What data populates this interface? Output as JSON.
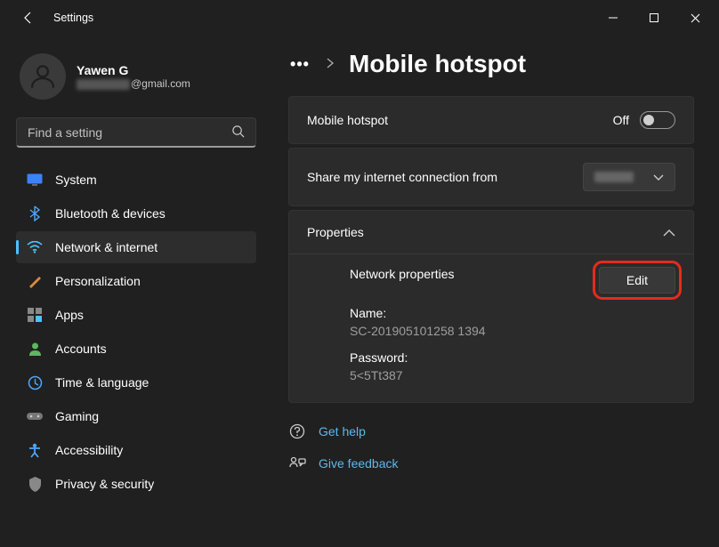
{
  "app": {
    "title": "Settings"
  },
  "profile": {
    "name": "Yawen G",
    "email_suffix": "@gmail.com"
  },
  "search": {
    "placeholder": "Find a setting"
  },
  "sidebar": {
    "items": [
      {
        "label": "System"
      },
      {
        "label": "Bluetooth & devices"
      },
      {
        "label": "Network & internet"
      },
      {
        "label": "Personalization"
      },
      {
        "label": "Apps"
      },
      {
        "label": "Accounts"
      },
      {
        "label": "Time & language"
      },
      {
        "label": "Gaming"
      },
      {
        "label": "Accessibility"
      },
      {
        "label": "Privacy & security"
      }
    ],
    "selected_index": 2
  },
  "page": {
    "title": "Mobile hotspot"
  },
  "panels": {
    "hotspot": {
      "label": "Mobile hotspot",
      "state_text": "Off"
    },
    "share_from": {
      "label": "Share my internet connection from"
    },
    "properties": {
      "header": "Properties",
      "section_label": "Network properties",
      "edit_label": "Edit",
      "name_label": "Name:",
      "name_value": "SC-201905101258 1394",
      "password_label": "Password:",
      "password_value": "5<5Tt387"
    }
  },
  "links": {
    "help": "Get help",
    "feedback": "Give feedback"
  }
}
